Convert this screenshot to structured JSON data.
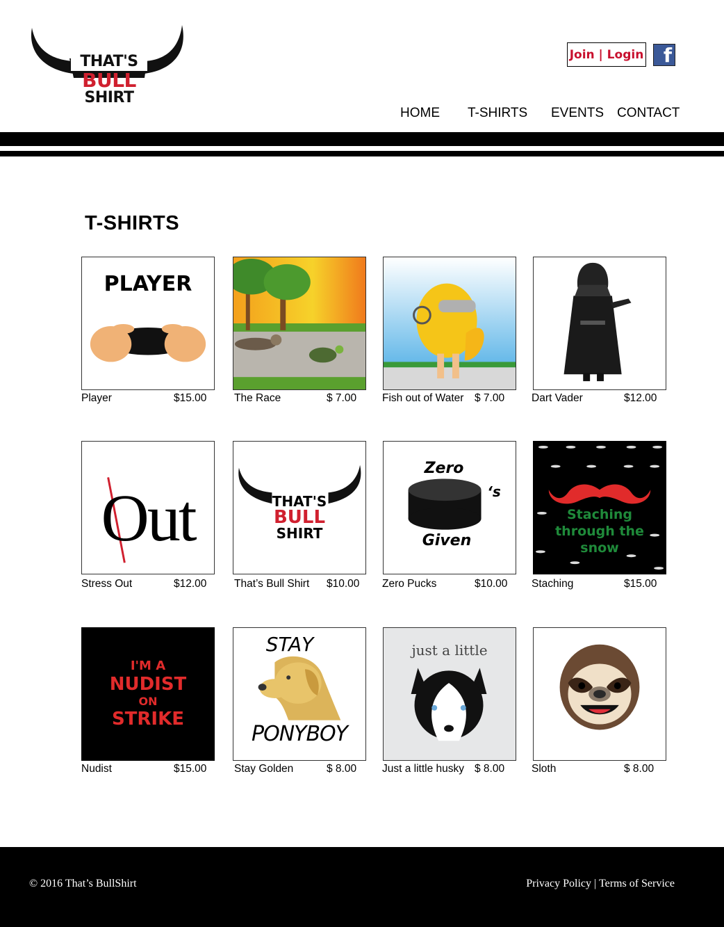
{
  "logo": {
    "line1": "THAT'S",
    "line2": "BULL",
    "line3": "SHIRT"
  },
  "header": {
    "join_login": "Join | Login",
    "facebook_glyph": "f",
    "nav": [
      "HOME",
      "T-SHIRTS",
      "EVENTS",
      "CONTACT"
    ]
  },
  "page_title": "T-SHIRTS",
  "products": [
    {
      "name": "Player",
      "price": "$15.00",
      "art": {
        "t1": "PLAYER"
      }
    },
    {
      "name": "The Race",
      "price": "$ 7.00"
    },
    {
      "name": "Fish out of Water",
      "price": "$ 7.00"
    },
    {
      "name": "Dart Vader",
      "price": "$12.00"
    },
    {
      "name": "Stress Out",
      "price": "$12.00",
      "art": {
        "t1": "Out"
      }
    },
    {
      "name": "That’s Bull Shirt",
      "price": "$10.00",
      "art": {
        "t1": "THAT'S",
        "t2": "BULL",
        "t3": "SHIRT"
      }
    },
    {
      "name": "Zero Pucks",
      "price": "$10.00",
      "art": {
        "t1": "Zero",
        "t2": "‘s",
        "t3": "Given"
      }
    },
    {
      "name": "Staching",
      "price": "$15.00",
      "art": {
        "t1": "Staching",
        "t2": "through the",
        "t3": "snow"
      }
    },
    {
      "name": "Nudist",
      "price": "$15.00",
      "art": {
        "t1": "I'M A",
        "t2": "NUDIST",
        "t3": "ON",
        "t4": "STRIKE"
      }
    },
    {
      "name": "Stay Golden",
      "price": "$ 8.00",
      "art": {
        "t1": "STAY",
        "t2": "PONYBOY"
      }
    },
    {
      "name": "Just a little husky",
      "price": "$ 8.00",
      "art": {
        "t1": "just a little"
      }
    },
    {
      "name": "Sloth",
      "price": "$ 8.00"
    }
  ],
  "footer": {
    "copyright": "© 2016 That’s BullShirt",
    "privacy": "Privacy Policy",
    "separator": "|",
    "terms": "Terms of Service"
  },
  "colors": {
    "brand_red": "#d0202f",
    "black": "#000000",
    "white": "#ffffff",
    "facebook_blue": "#3b5998"
  }
}
